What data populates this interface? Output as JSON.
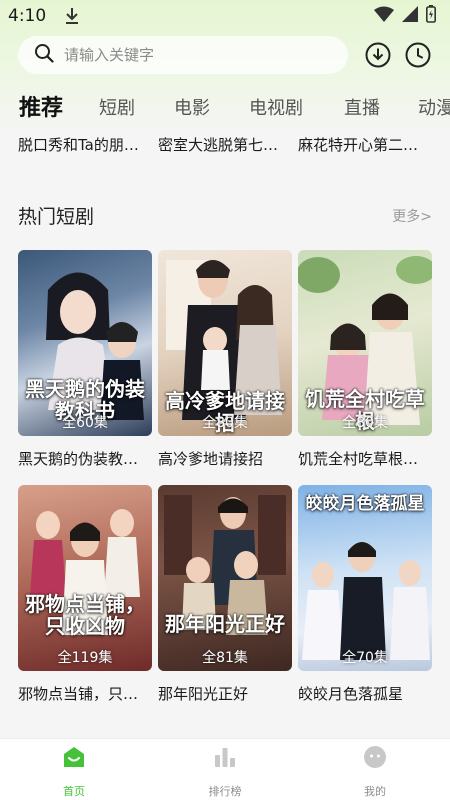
{
  "status": {
    "time": "4:10"
  },
  "search": {
    "placeholder": "请输入关键字"
  },
  "tabs": [
    {
      "label": "推荐"
    },
    {
      "label": "短剧"
    },
    {
      "label": "电影"
    },
    {
      "label": "电视剧"
    },
    {
      "label": "直播"
    },
    {
      "label": "动漫"
    }
  ],
  "prev_row": [
    {
      "title": "脱口秀和Ta的朋…"
    },
    {
      "title": "密室大逃脱第七…"
    },
    {
      "title": "麻花特开心第二…"
    }
  ],
  "section": {
    "title": "热门短剧",
    "more": "更多>"
  },
  "cards": [
    {
      "title": "黑天鹅的伪装教…",
      "episodes": "全60集",
      "poster_text": "黑天鹅的伪装教科书"
    },
    {
      "title": "高冷爹地请接招",
      "episodes": "全80集",
      "poster_text": "高冷爹地请接招"
    },
    {
      "title": "饥荒全村吃草根…",
      "episodes": "全80集",
      "poster_text": "饥荒全村吃草根"
    },
    {
      "title": "邪物点当铺，只…",
      "episodes": "全119集",
      "poster_text": "邪物点当铺，只收凶物"
    },
    {
      "title": "那年阳光正好",
      "episodes": "全81集",
      "poster_text": "那年阳光正好"
    },
    {
      "title": "皎皎月色落孤星",
      "episodes": "全70集",
      "poster_text": "皎皎月色落孤星"
    }
  ],
  "nav": [
    {
      "label": "首页",
      "icon": "home-icon",
      "active": true
    },
    {
      "label": "排行榜",
      "icon": "ranking-icon",
      "active": false
    },
    {
      "label": "我的",
      "icon": "profile-icon",
      "active": false
    }
  ],
  "colors": {
    "accent": "#45c23a",
    "header_bg": "#e6f6d2"
  }
}
